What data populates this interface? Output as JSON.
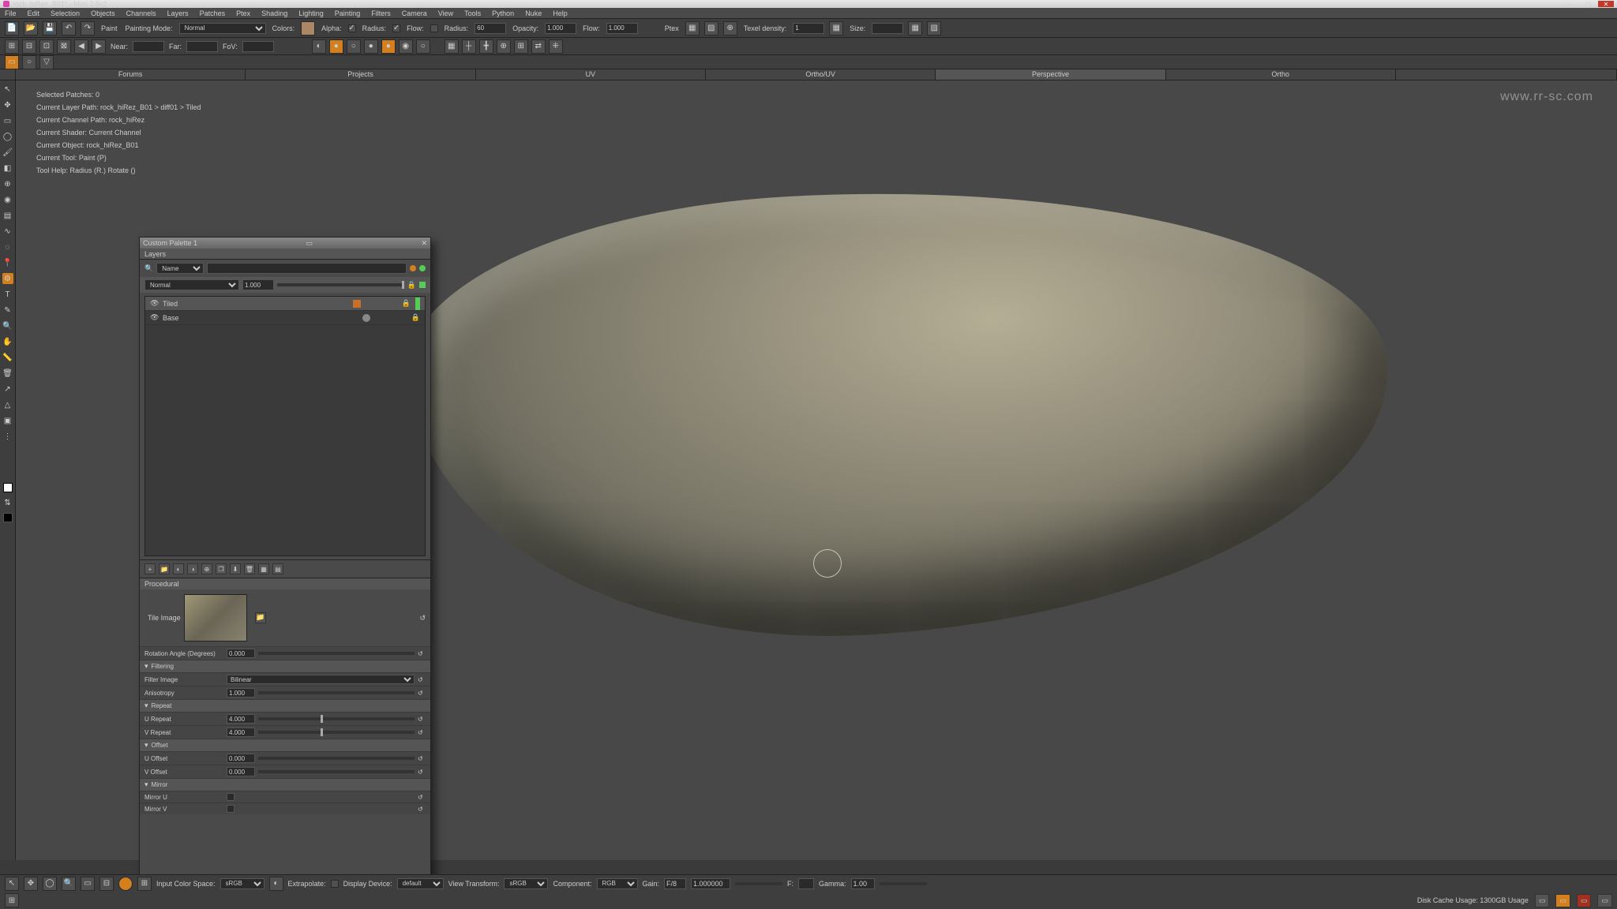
{
  "window": {
    "title": "rock_hiRez_B01* - Mari 2.6v2",
    "url_watermark": "www.rr-sc.com"
  },
  "menubar": [
    "File",
    "Edit",
    "Selection",
    "Objects",
    "Channels",
    "Layers",
    "Patches",
    "Ptex",
    "Shading",
    "Lighting",
    "Painting",
    "Filters",
    "Camera",
    "View",
    "Tools",
    "Python",
    "Nuke",
    "Help"
  ],
  "toolbar1": {
    "paint_label": "Paint",
    "mode_label": "Painting Mode:",
    "mode_value": "Normal",
    "colors_label": "Colors:",
    "alpha_label": "Alpha:",
    "alpha_chk": true,
    "radius_label": "Radius:",
    "radius_chk": true,
    "flow_label": "Flow:",
    "radius2_label": "Radius:",
    "radius2_value": "60",
    "opacity_label": "Opacity:",
    "opacity_value": "1.000",
    "flow2_label": "Flow:",
    "flow2_value": "1.000",
    "ptex_label": "Ptex",
    "texel_label": "Texel density:",
    "texel_value": "1",
    "size_label": "Size:",
    "size_value": ""
  },
  "toolbar2": {
    "near_label": "Near:",
    "far_label": "Far:",
    "fov_label": "FoV:"
  },
  "tabs": {
    "items": [
      "Forums",
      "Projects",
      "UV",
      "Ortho/UV",
      "Perspective",
      "Ortho"
    ],
    "active": 4
  },
  "info": {
    "selected_patches": "Selected Patches: 0",
    "layer_path": "Current Layer Path: rock_hiRez_B01 > diff01 > Tiled",
    "channel_path": "Current Channel Path: rock_hiRez",
    "shader": "Current Shader: Current Channel",
    "object": "Current Object: rock_hiRez_B01",
    "tool": "Current Tool: Paint (P)",
    "help": "Tool Help:   Radius (R.)   Rotate ()"
  },
  "panel": {
    "title": "Custom Palette 1",
    "tab": "Layers",
    "search_mode": "Name",
    "blend_mode": "Normal",
    "blend_opacity": "1.000",
    "layers": [
      {
        "name": "Tiled",
        "selected": true,
        "color": "orange"
      },
      {
        "name": "Base",
        "selected": false,
        "color": "gray"
      }
    ],
    "procedural_label": "Procedural",
    "tile_image_label": "Tile Image",
    "properties": {
      "rotation": {
        "label": "Rotation Angle (Degrees)",
        "value": "0.000"
      },
      "filtering_hdr": "Filtering",
      "filter_image": {
        "label": "Filter Image",
        "value": "Bilinear"
      },
      "anisotropy": {
        "label": "Anisotropy",
        "value": "1.000"
      },
      "repeat_hdr": "Repeat",
      "u_repeat": {
        "label": "U Repeat",
        "value": "4.000"
      },
      "v_repeat": {
        "label": "V Repeat",
        "value": "4.000"
      },
      "offset_hdr": "Offset",
      "u_offset": {
        "label": "U Offset",
        "value": "0.000"
      },
      "v_offset": {
        "label": "V Offset",
        "value": "0.000"
      },
      "mirror_hdr": "Mirror",
      "mirror_u": {
        "label": "Mirror U"
      },
      "mirror_v": {
        "label": "Mirror V"
      }
    },
    "bottom_tab": "Layers"
  },
  "statusbar": {
    "input_cs_label": "Input Color Space:",
    "input_cs_value": "sRGB",
    "extrapolate_label": "Extrapolate:",
    "display_device_label": "Display Device:",
    "display_device_value": "default",
    "view_transform_label": "View Transform:",
    "view_transform_value": "sRGB",
    "component_label": "Component:",
    "component_value": "RGB",
    "gain_label": "Gain:",
    "gain_value": "1.000000",
    "gain_short": "F/8",
    "f_label": "F:",
    "gamma_label": "Gamma:",
    "gamma_value": "1.00"
  },
  "bottombar": {
    "disk_cache": "Disk Cache Usage: 1300GB Usage"
  }
}
